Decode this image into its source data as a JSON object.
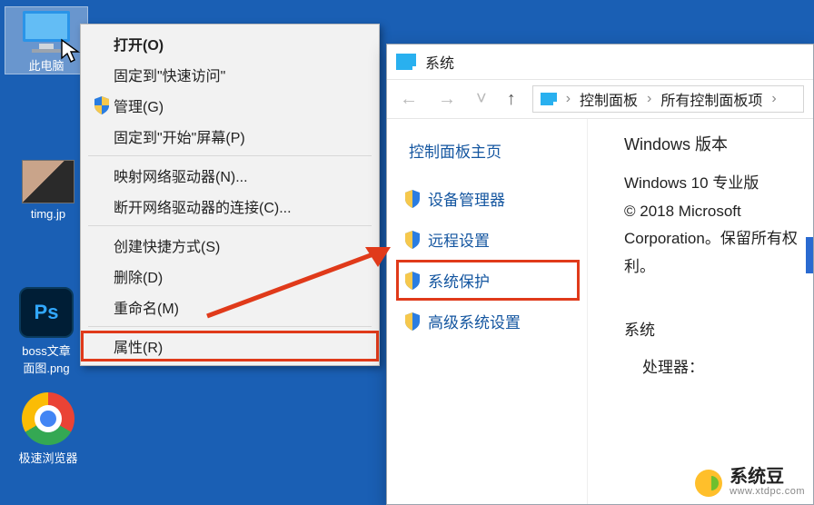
{
  "desktop": {
    "this_pc": "此电脑",
    "img_file": "timg.jp",
    "ps_file": "boss文章\n面图.png",
    "browser": "极速浏览器"
  },
  "context_menu": {
    "open": "打开(O)",
    "pin_quick": "固定到\"快速访问\"",
    "manage": "管理(G)",
    "pin_start": "固定到\"开始\"屏幕(P)",
    "map_drive": "映射网络驱动器(N)...",
    "disconnect_drive": "断开网络驱动器的连接(C)...",
    "create_shortcut": "创建快捷方式(S)",
    "delete": "删除(D)",
    "rename": "重命名(M)",
    "properties": "属性(R)"
  },
  "system_window": {
    "title": "系统",
    "breadcrumb": {
      "a": "控制面板",
      "b": "所有控制面板项"
    },
    "left_title": "控制面板主页",
    "links": {
      "device_manager": "设备管理器",
      "remote": "远程设置",
      "protection": "系统保护",
      "advanced": "高级系统设置"
    },
    "right": {
      "section": "Windows 版本",
      "edition": "Windows 10 专业版",
      "copyright": "© 2018 Microsoft Corporation。保留所有权利。",
      "hw_section": "系统",
      "cpu_label": "处理器："
    }
  },
  "watermark": {
    "name": "系统豆",
    "url": "www.xtdpc.com"
  }
}
